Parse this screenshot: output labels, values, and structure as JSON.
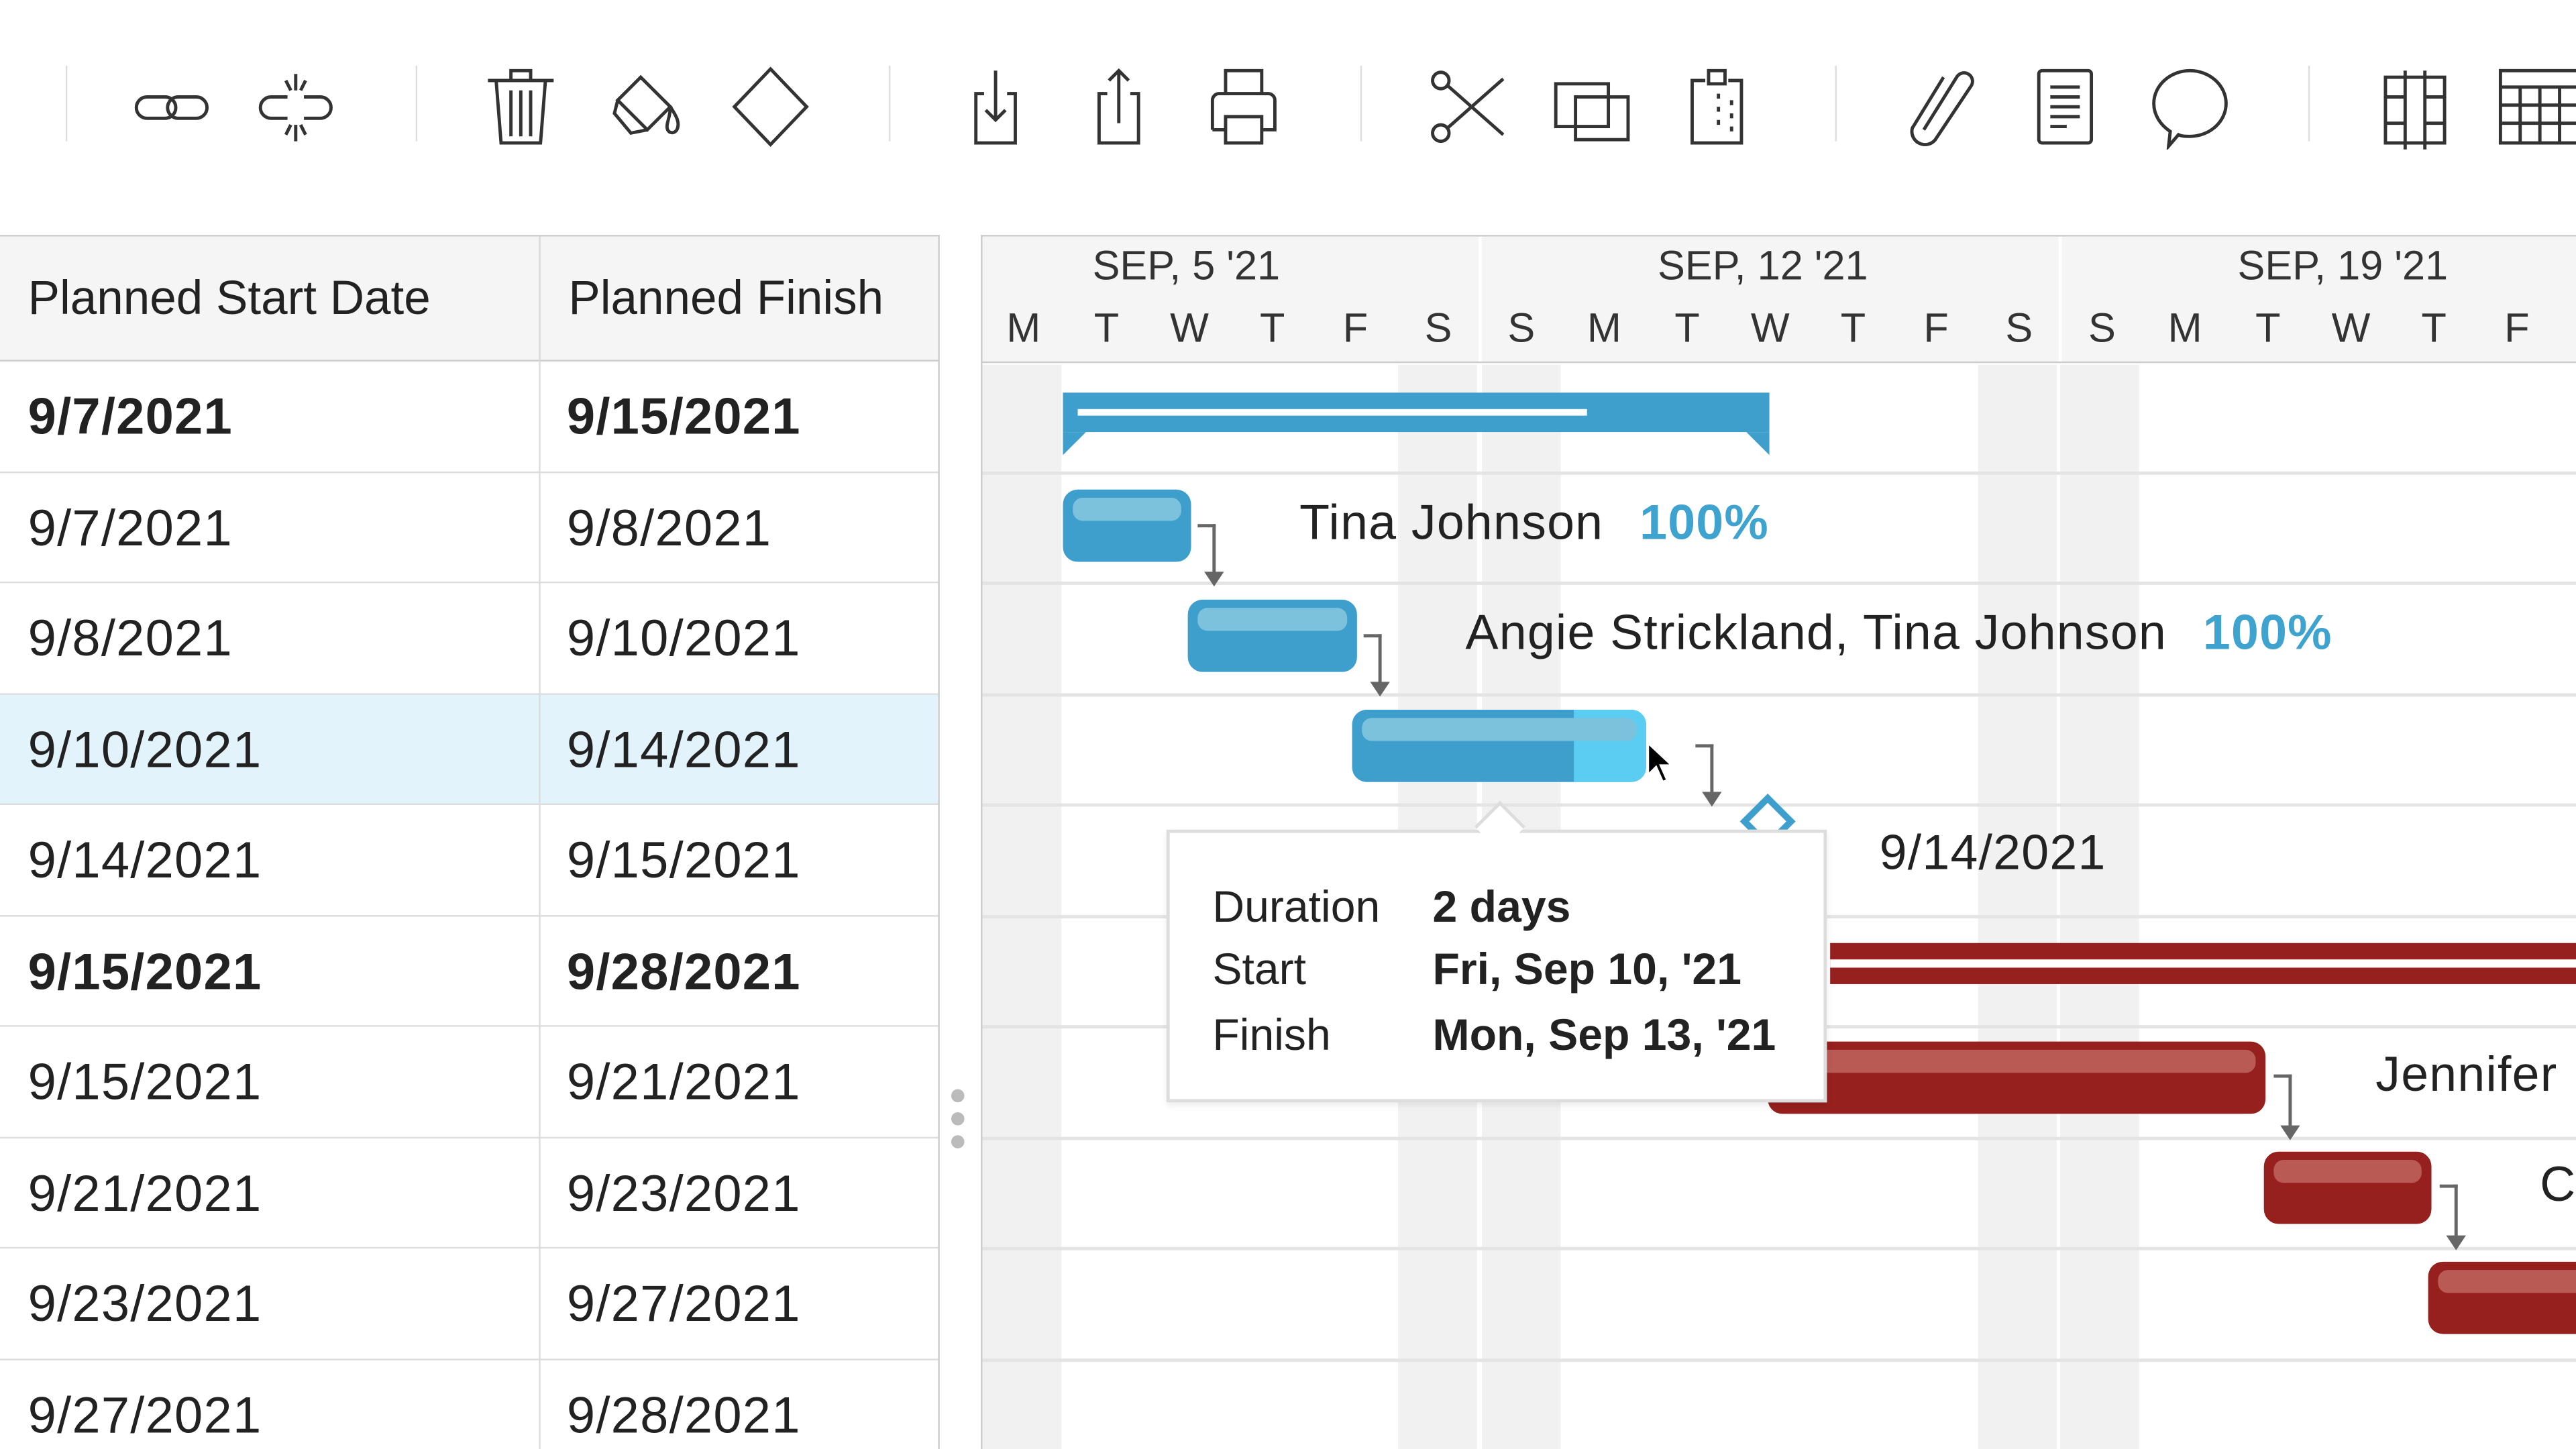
{
  "toolbar": {
    "groups": [
      [
        "link-icon",
        "unlink-icon"
      ],
      [
        "trash-icon",
        "paint-bucket-icon",
        "milestone-diamond-icon"
      ],
      [
        "import-icon",
        "export-icon",
        "print-icon"
      ],
      [
        "cut-icon",
        "copy-icon",
        "paste-icon"
      ],
      [
        "attachment-icon",
        "notes-icon",
        "comment-icon"
      ],
      [
        "columns-icon",
        "grid-icon"
      ]
    ]
  },
  "table": {
    "columns": [
      "Planned Start Date",
      "Planned Finish"
    ],
    "rows": [
      {
        "start": "9/7/2021",
        "finish": "9/15/2021",
        "bold": true
      },
      {
        "start": "9/7/2021",
        "finish": "9/8/2021"
      },
      {
        "start": "9/8/2021",
        "finish": "9/10/2021"
      },
      {
        "start": "9/10/2021",
        "finish": "9/14/2021",
        "selected": true
      },
      {
        "start": "9/14/2021",
        "finish": "9/15/2021"
      },
      {
        "start": "9/15/2021",
        "finish": "9/28/2021",
        "bold": true
      },
      {
        "start": "9/15/2021",
        "finish": "9/21/2021"
      },
      {
        "start": "9/21/2021",
        "finish": "9/23/2021"
      },
      {
        "start": "9/23/2021",
        "finish": "9/27/2021"
      },
      {
        "start": "9/27/2021",
        "finish": "9/28/2021"
      }
    ]
  },
  "gantt": {
    "weeks": [
      "SEP, 5 '21",
      "SEP, 12 '21",
      "SEP, 19 '21"
    ],
    "days": [
      "M",
      "T",
      "W",
      "T",
      "F",
      "S",
      "S",
      "M",
      "T",
      "W",
      "T",
      "F",
      "S",
      "S",
      "M",
      "T",
      "W",
      "T",
      "F"
    ],
    "tasks": [
      {
        "assignee": "Tina Johnson",
        "progress": "100%"
      },
      {
        "assignee": "Angie Strickland, Tina Johnson",
        "progress": "100%"
      },
      {
        "milestone_date": "9/14/2021"
      },
      {
        "assignee": "Jennifer"
      },
      {
        "assignee": "C"
      }
    ],
    "colors": {
      "phase1": "#3f9fcc",
      "phase2": "#96201e",
      "progress_text": "#3fa3d0"
    }
  },
  "tooltip": {
    "duration_label": "Duration",
    "duration": "2 days",
    "start_label": "Start",
    "start": "Fri, Sep 10, '21",
    "finish_label": "Finish",
    "finish": "Mon, Sep 13, '21"
  }
}
